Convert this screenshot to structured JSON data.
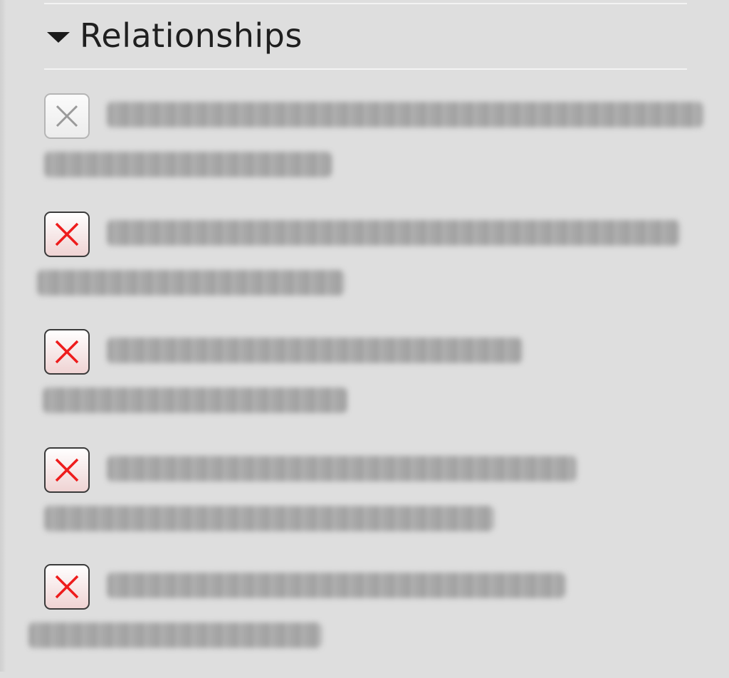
{
  "panel": {
    "section": {
      "title": "Relationships",
      "icon": "disclosure-triangle-down-icon",
      "expanded": true
    },
    "relationships": [
      {
        "remove_enabled": false,
        "remove_icon": "close-x-icon",
        "text_line1": "",
        "text_line2": ""
      },
      {
        "remove_enabled": true,
        "remove_icon": "close-x-icon",
        "text_line1": "",
        "text_line2": ""
      },
      {
        "remove_enabled": true,
        "remove_icon": "close-x-icon",
        "text_line1": "",
        "text_line2": ""
      },
      {
        "remove_enabled": true,
        "remove_icon": "close-x-icon",
        "text_line1": "",
        "text_line2": ""
      },
      {
        "remove_enabled": true,
        "remove_icon": "close-x-icon",
        "text_line1": "",
        "text_line2": ""
      }
    ],
    "colors": {
      "background": "#dedede",
      "remove_x_active": "#ee1c1c",
      "remove_x_disabled": "#9a9a9a"
    }
  }
}
